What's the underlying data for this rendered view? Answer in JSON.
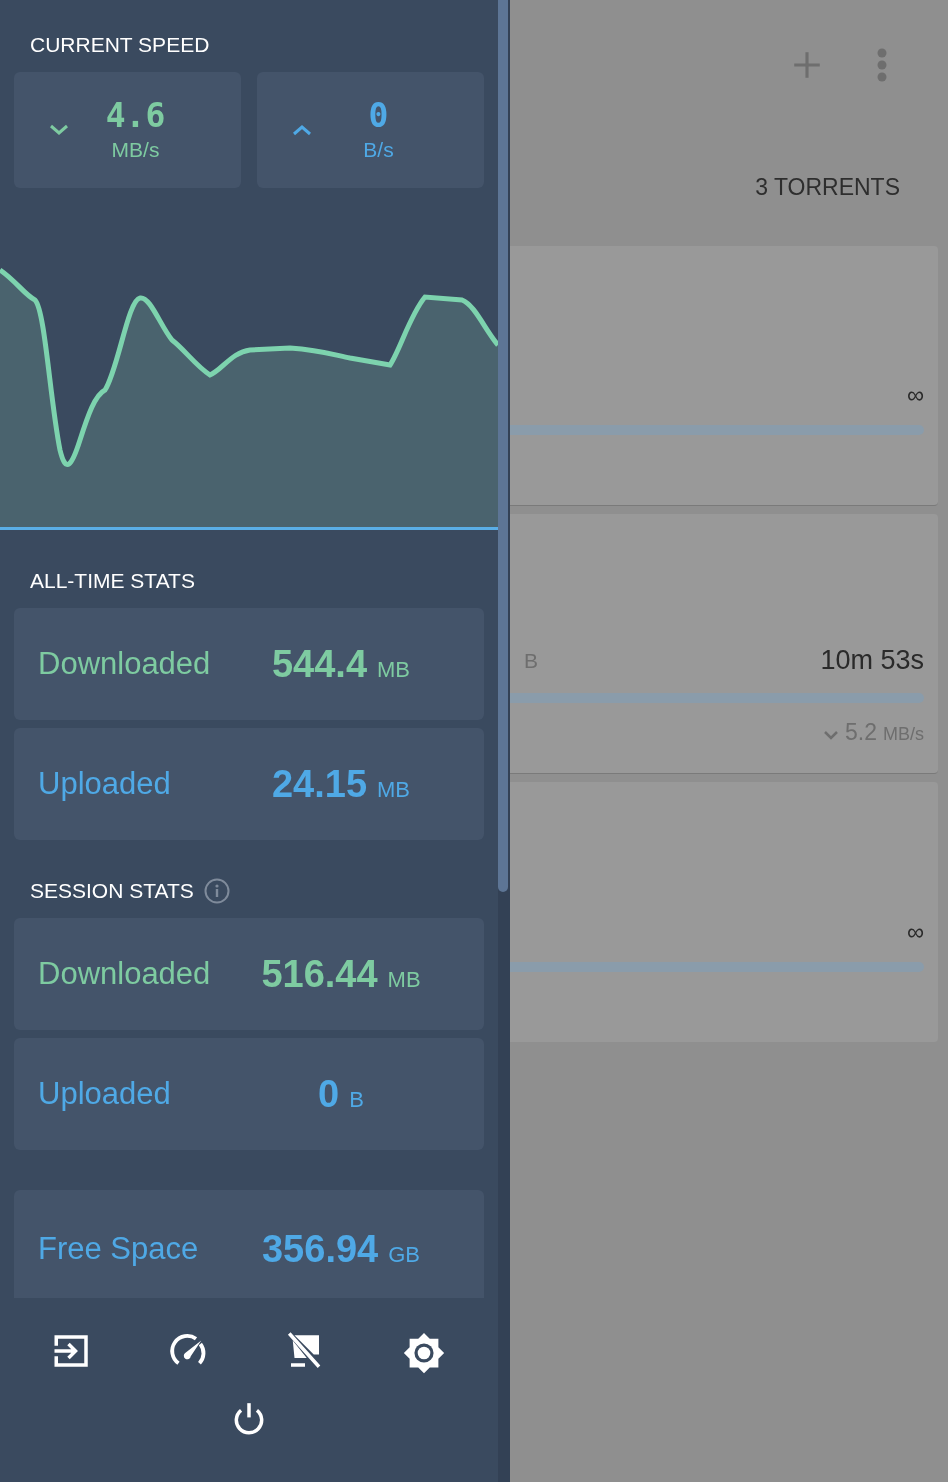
{
  "speed": {
    "title": "CURRENT SPEED",
    "items": [
      {
        "kind": "download",
        "value": "4.6",
        "unit": "MB/s"
      },
      {
        "kind": "upload",
        "value": "0",
        "unit": "B/s"
      }
    ]
  },
  "all_time": {
    "title": "ALL-TIME STATS",
    "items": [
      {
        "kind": "download",
        "label": "Downloaded",
        "value": "544.4",
        "unit": "MB"
      },
      {
        "kind": "upload",
        "label": "Uploaded",
        "value": "24.15",
        "unit": "MB"
      }
    ]
  },
  "session": {
    "title": "SESSION STATS",
    "items": [
      {
        "kind": "download",
        "label": "Downloaded",
        "value": "516.44",
        "unit": "MB"
      },
      {
        "kind": "upload",
        "label": "Uploaded",
        "value": "0",
        "unit": "B"
      }
    ]
  },
  "free_space": {
    "kind": "upload",
    "label": "Free Space",
    "value": "356.94",
    "unit": "GB"
  },
  "background": {
    "count": "3 TORRENTS",
    "torrents": [
      {
        "eta": "∞",
        "level": 1
      },
      {
        "size_unit": "B",
        "eta": "10m 53s",
        "speed": "5.2",
        "speed_unit": "MB/s",
        "level": 1
      },
      {
        "eta": "∞",
        "level": 1
      }
    ]
  }
}
